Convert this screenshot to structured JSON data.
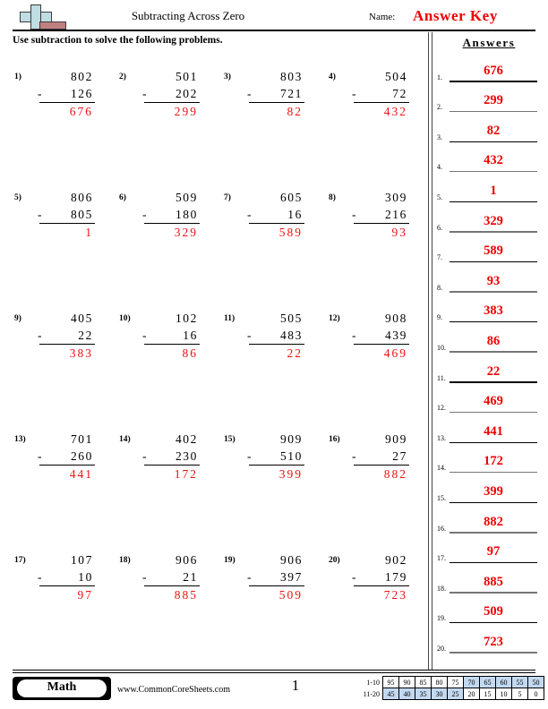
{
  "header": {
    "title": "Subtracting Across Zero",
    "name_label": "Name:",
    "name_value": "Answer Key",
    "instructions": "Use subtraction to solve the following problems.",
    "logo_icon": "plus-minus-logo-icon"
  },
  "answers_panel": {
    "title": "Answers",
    "rows": [
      {
        "idx": "1.",
        "value": "676"
      },
      {
        "idx": "2.",
        "value": "299"
      },
      {
        "idx": "3.",
        "value": "82"
      },
      {
        "idx": "4.",
        "value": "432"
      },
      {
        "idx": "5.",
        "value": "1"
      },
      {
        "idx": "6.",
        "value": "329"
      },
      {
        "idx": "7.",
        "value": "589"
      },
      {
        "idx": "8.",
        "value": "93"
      },
      {
        "idx": "9.",
        "value": "383"
      },
      {
        "idx": "10.",
        "value": "86"
      },
      {
        "idx": "11.",
        "value": "22"
      },
      {
        "idx": "12.",
        "value": "469"
      },
      {
        "idx": "13.",
        "value": "441"
      },
      {
        "idx": "14.",
        "value": "172"
      },
      {
        "idx": "15.",
        "value": "399"
      },
      {
        "idx": "16.",
        "value": "882"
      },
      {
        "idx": "17.",
        "value": "97"
      },
      {
        "idx": "18.",
        "value": "885"
      },
      {
        "idx": "19.",
        "value": "509"
      },
      {
        "idx": "20.",
        "value": "723"
      }
    ]
  },
  "problems": [
    {
      "num": "1)",
      "minuend": "802",
      "op": "-",
      "subtrahend": "126",
      "answer": "676"
    },
    {
      "num": "2)",
      "minuend": "501",
      "op": "-",
      "subtrahend": "202",
      "answer": "299"
    },
    {
      "num": "3)",
      "minuend": "803",
      "op": "-",
      "subtrahend": "721",
      "answer": "82"
    },
    {
      "num": "4)",
      "minuend": "504",
      "op": "-",
      "subtrahend": "72",
      "answer": "432"
    },
    {
      "num": "5)",
      "minuend": "806",
      "op": "-",
      "subtrahend": "805",
      "answer": "1"
    },
    {
      "num": "6)",
      "minuend": "509",
      "op": "-",
      "subtrahend": "180",
      "answer": "329"
    },
    {
      "num": "7)",
      "minuend": "605",
      "op": "-",
      "subtrahend": "16",
      "answer": "589"
    },
    {
      "num": "8)",
      "minuend": "309",
      "op": "-",
      "subtrahend": "216",
      "answer": "93"
    },
    {
      "num": "9)",
      "minuend": "405",
      "op": "-",
      "subtrahend": "22",
      "answer": "383"
    },
    {
      "num": "10)",
      "minuend": "102",
      "op": "-",
      "subtrahend": "16",
      "answer": "86"
    },
    {
      "num": "11)",
      "minuend": "505",
      "op": "-",
      "subtrahend": "483",
      "answer": "22"
    },
    {
      "num": "12)",
      "minuend": "908",
      "op": "-",
      "subtrahend": "439",
      "answer": "469"
    },
    {
      "num": "13)",
      "minuend": "701",
      "op": "-",
      "subtrahend": "260",
      "answer": "441"
    },
    {
      "num": "14)",
      "minuend": "402",
      "op": "-",
      "subtrahend": "230",
      "answer": "172"
    },
    {
      "num": "15)",
      "minuend": "909",
      "op": "-",
      "subtrahend": "510",
      "answer": "399"
    },
    {
      "num": "16)",
      "minuend": "909",
      "op": "-",
      "subtrahend": "27",
      "answer": "882"
    },
    {
      "num": "17)",
      "minuend": "107",
      "op": "-",
      "subtrahend": "10",
      "answer": "97"
    },
    {
      "num": "18)",
      "minuend": "906",
      "op": "-",
      "subtrahend": "21",
      "answer": "885"
    },
    {
      "num": "19)",
      "minuend": "906",
      "op": "-",
      "subtrahend": "397",
      "answer": "509"
    },
    {
      "num": "20)",
      "minuend": "902",
      "op": "-",
      "subtrahend": "179",
      "answer": "723"
    }
  ],
  "footer": {
    "subject_badge": "Math",
    "website": "www.CommonCoreSheets.com",
    "page_number": "1"
  },
  "score_grid": {
    "row1_label": "1-10",
    "row2_label": "11-20",
    "row1": [
      "95",
      "90",
      "85",
      "80",
      "75",
      "70",
      "65",
      "60",
      "55",
      "50"
    ],
    "row2": [
      "45",
      "40",
      "35",
      "30",
      "25",
      "20",
      "15",
      "10",
      "5",
      "0"
    ],
    "row1_highlighted": [
      false,
      false,
      false,
      false,
      false,
      true,
      true,
      true,
      true,
      true
    ],
    "row2_highlighted": [
      true,
      true,
      true,
      true,
      true,
      false,
      false,
      false,
      false,
      false
    ],
    "highlight_color": "#c3d9f0"
  },
  "colors": {
    "answer_red": "#ee0000",
    "logo_plus": "#bfdde2",
    "logo_minus": "#c08080"
  }
}
